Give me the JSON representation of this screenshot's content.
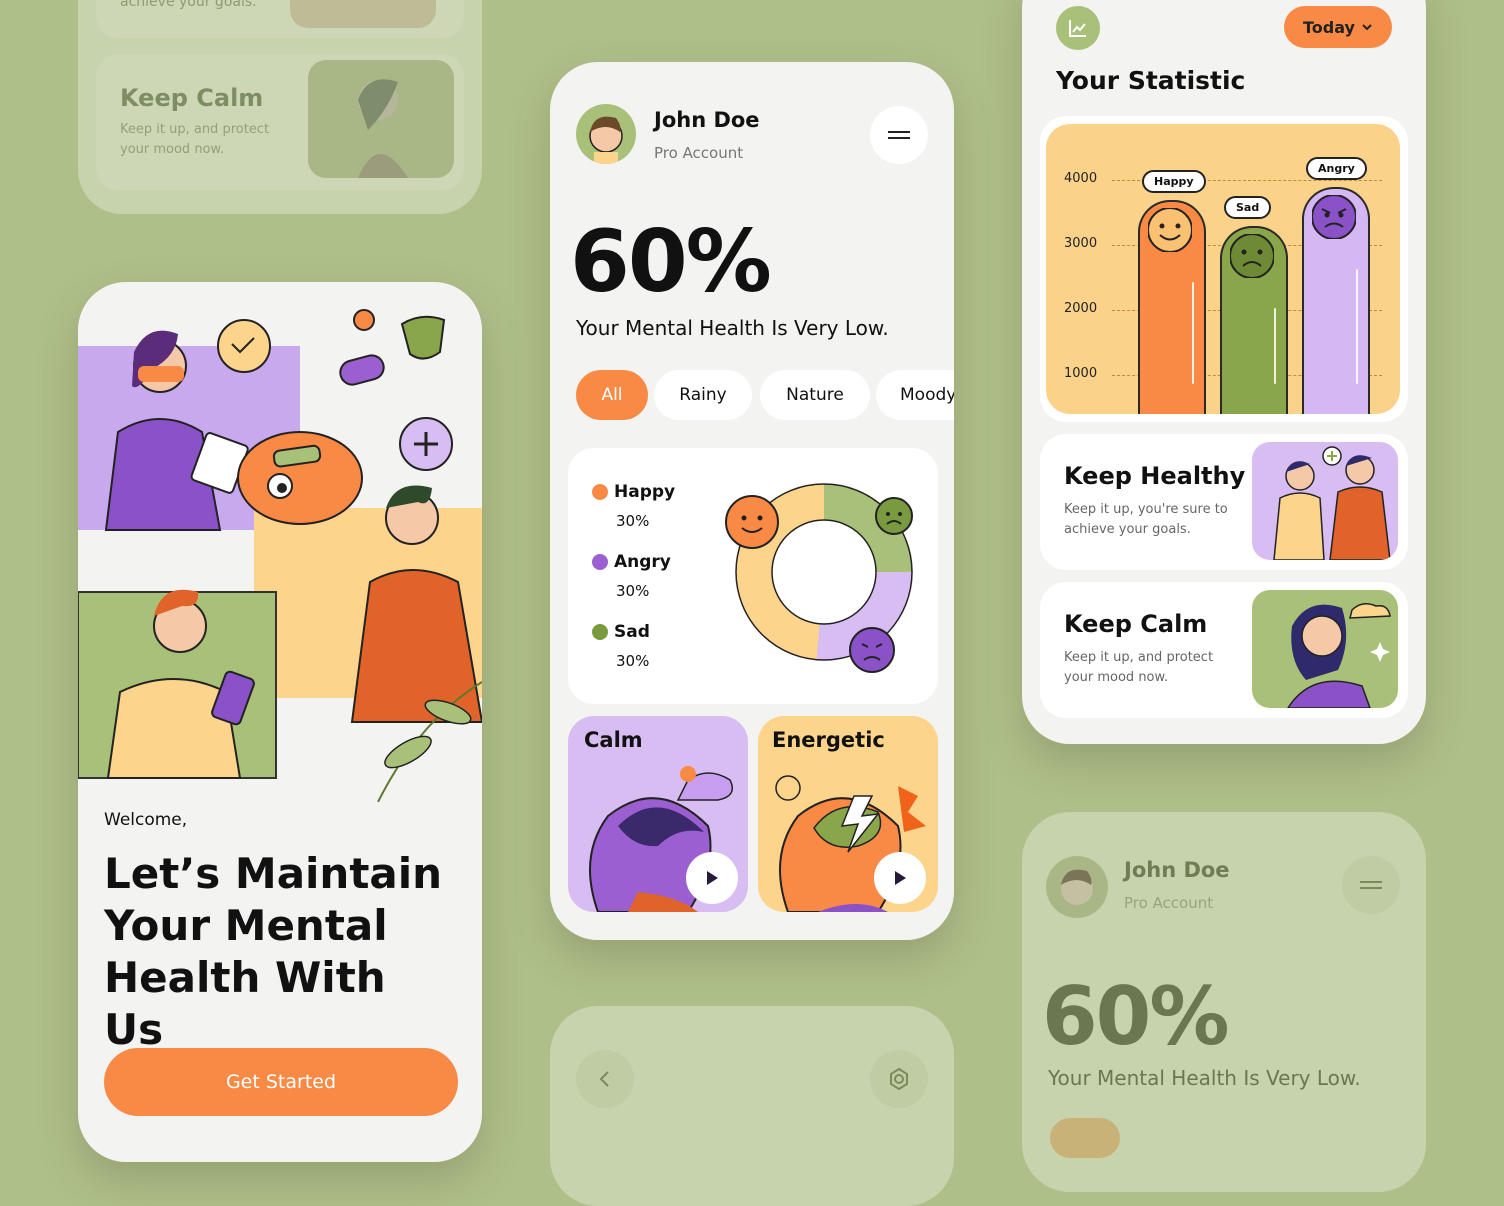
{
  "top_left_card": {
    "partial_text": "achieve your goals.",
    "keep_calm_title": "Keep Calm",
    "keep_calm_desc": "Keep it up, and protect your mood now."
  },
  "welcome_screen": {
    "greeting": "Welcome,",
    "headline": "Let’s Maintain Your Mental Health With Us",
    "cta_label": "Get Started"
  },
  "profile": {
    "name": "John Doe",
    "account": "Pro Account",
    "percent": "60%",
    "status": "Your Mental Health Is Very Low."
  },
  "filters": [
    "All",
    "Rainy",
    "Nature",
    "Moody"
  ],
  "mood_legend": [
    {
      "name": "Happy",
      "value": "30%",
      "color": "#f98a45"
    },
    {
      "name": "Angry",
      "value": "30%",
      "color": "#9c5fd1"
    },
    {
      "name": "Sad",
      "value": "30%",
      "color": "#7a9a40"
    }
  ],
  "categories": [
    {
      "label": "Calm",
      "color": "#d7bdf2"
    },
    {
      "label": "Energetic",
      "color": "#fcd48c"
    }
  ],
  "statistic": {
    "title": "Your Statistic",
    "period_button": "Today",
    "chart_bg": "#fbd28a"
  },
  "chart_data": {
    "type": "bar",
    "categories": [
      "Happy",
      "Sad",
      "Angry"
    ],
    "values": [
      3700,
      3300,
      3900
    ],
    "colors": [
      "#f98a45",
      "#8aa64a",
      "#d5b8f3"
    ],
    "yticks": [
      "4000",
      "3000",
      "2000",
      "1000"
    ],
    "ylim": [
      0,
      4500
    ],
    "grid": "dashed"
  },
  "stat_cards": [
    {
      "title": "Keep Healthy",
      "desc": "Keep it up, you're sure to achieve your goals."
    },
    {
      "title": "Keep Calm",
      "desc": "Keep it up, and protect your mood now."
    }
  ],
  "faded_profile": {
    "name": "John Doe",
    "account": "Pro Account",
    "percent": "60%",
    "status": "Your Mental Health Is Very Low."
  }
}
